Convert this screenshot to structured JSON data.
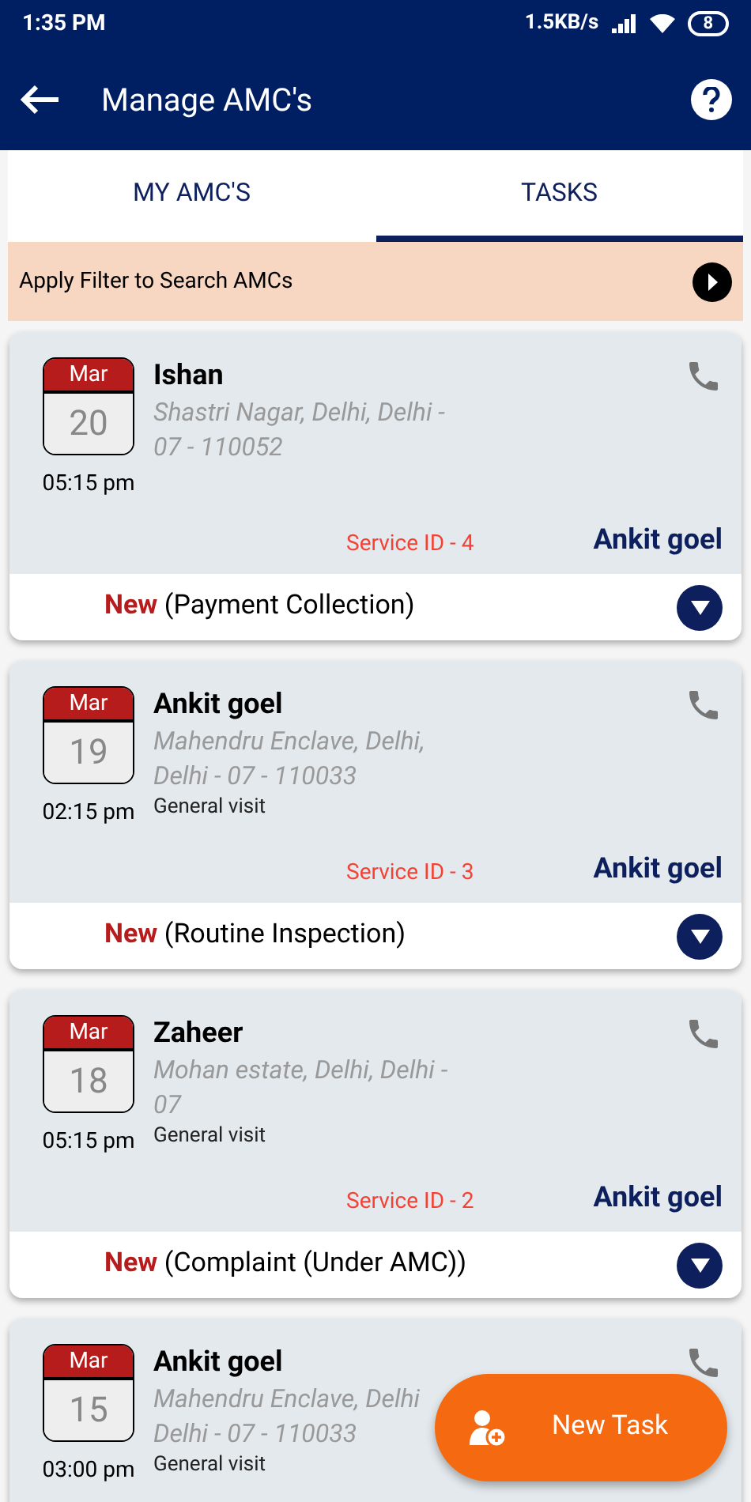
{
  "status_bar": {
    "time": "1:35 PM",
    "speed": "1.5KB/s",
    "battery": "8"
  },
  "app_bar": {
    "title": "Manage AMC's"
  },
  "tabs": [
    {
      "label": "MY AMC'S",
      "selected": false
    },
    {
      "label": "TASKS",
      "selected": true
    }
  ],
  "filter": {
    "label": "Apply Filter to Search AMCs"
  },
  "tasks": [
    {
      "month": "Mar",
      "day": "20",
      "time": "05:15 pm",
      "name": "Ishan",
      "address": "Shastri Nagar, Delhi, Delhi - 07 - 110052",
      "service_id": "Service ID - 4",
      "assignee": "Ankit goel",
      "status": "New",
      "category": "(Payment Collection)"
    },
    {
      "month": "Mar",
      "day": "19",
      "time": "02:15 pm",
      "name": "Ankit goel",
      "address": "Mahendru Enclave, Delhi, Delhi - 07 - 110033",
      "visit_type": "General visit",
      "service_id": "Service ID - 3",
      "assignee": "Ankit goel",
      "status": "New",
      "category": "(Routine Inspection)"
    },
    {
      "month": "Mar",
      "day": "18",
      "time": "05:15 pm",
      "name": "Zaheer",
      "address": "Mohan estate, Delhi, Delhi - 07",
      "visit_type": "General visit",
      "service_id": "Service ID - 2",
      "assignee": "Ankit goel",
      "status": "New",
      "category": "(Complaint (Under AMC))"
    },
    {
      "month": "Mar",
      "day": "15",
      "time": "03:00 pm",
      "name": "Ankit goel",
      "address": "Mahendru Enclave, Delhi",
      "address_2": "Delhi - 07 - 110033",
      "visit_type": "General visit"
    }
  ],
  "fab": {
    "label": "New Task"
  }
}
